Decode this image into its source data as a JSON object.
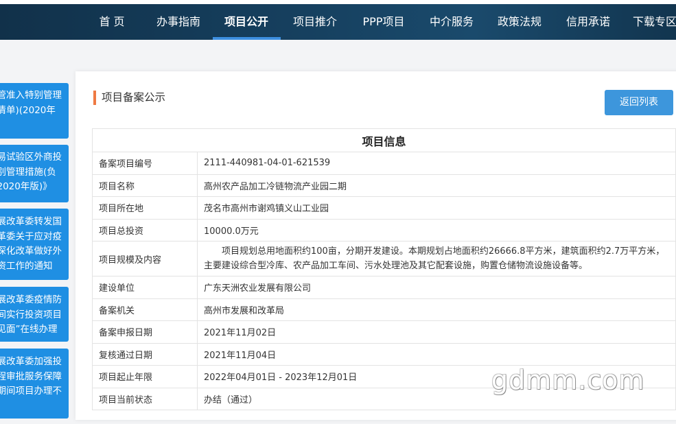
{
  "nav": {
    "items": [
      {
        "label": "首 页"
      },
      {
        "label": "办事指南"
      },
      {
        "label": "项目公开"
      },
      {
        "label": "项目推介"
      },
      {
        "label": "PPP项目"
      },
      {
        "label": "中介服务"
      },
      {
        "label": "政策法规"
      },
      {
        "label": "信用承诺"
      },
      {
        "label": "下载专区"
      }
    ],
    "active_index": 2
  },
  "sidebar": {
    "items": [
      {
        "lines": [
          "管准入特别管理",
          "清单)(2020年",
          ""
        ]
      },
      {
        "lines": [
          "易试验区外商投",
          "别管理措施(负",
          "2020年版)》"
        ]
      },
      {
        "lines": [
          "展改革委转发国",
          "革委关于应对疫",
          "深化改革做好外",
          "资工作的通知"
        ]
      },
      {
        "lines": [
          "展改革委疫情防",
          "间实行投资项目",
          "见面”在线办理"
        ]
      },
      {
        "lines": [
          "展改革委加强投",
          "程审批服务保障",
          "期间项目办理不"
        ]
      }
    ]
  },
  "card": {
    "title": "项目备案公示",
    "back_button": "返回列表"
  },
  "table": {
    "header": "项目信息",
    "rows": [
      {
        "key": "备案项目编号",
        "value": "2111-440981-04-01-621539"
      },
      {
        "key": "项目名称",
        "value": "高州农产品加工冷链物流产业园二期"
      },
      {
        "key": "项目所在地",
        "value": "茂名市高州市谢鸡镇义山工业园"
      },
      {
        "key": "项目总投资",
        "value": "10000.0万元"
      },
      {
        "key": "项目规模及内容",
        "value": "项目规划总用地面积约100亩，分期开发建设。本期规划占地面积约26666.8平方米，建筑面积约2.7万平方米，主要建设综合型冷库、农产品加工车间、污水处理池及其它配套设施，购置仓储物流设施设备等。"
      },
      {
        "key": "建设单位",
        "value": "广东天洲农业发展有限公司"
      },
      {
        "key": "备案机关",
        "value": "高州市发展和改革局"
      },
      {
        "key": "备案申报日期",
        "value": "2021年11月02日"
      },
      {
        "key": "复核通过日期",
        "value": "2021年11月04日"
      },
      {
        "key": "项目起止年限",
        "value": "2022年04月01日 - 2023年12月01日"
      },
      {
        "key": "项目当前状态",
        "value": "办结（通过）"
      }
    ]
  },
  "watermark": "gdmm.com",
  "colors": {
    "nav_bg": "#16405f",
    "nav_active_underline": "#3d8fe0",
    "sidebar_bg": "#1f8fe3",
    "title_accent": "#ef7a43",
    "button_bg": "#3d96dc"
  }
}
